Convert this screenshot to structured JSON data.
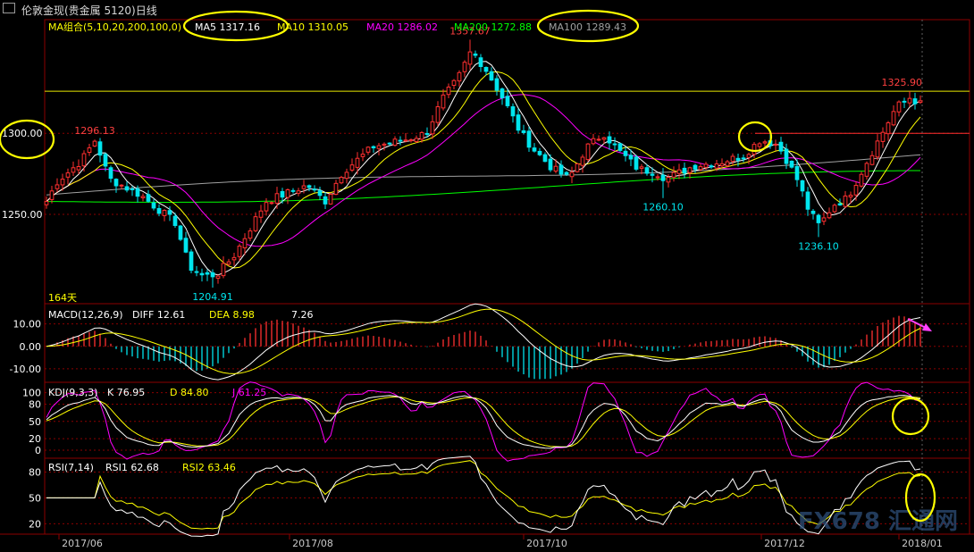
{
  "window": {
    "title": "伦敦金现(贵金属 5120)日线"
  },
  "main_panel": {
    "legend_prefix": "MA组合(5,10,20,200,100,0)",
    "ma_labels": [
      {
        "text": "MA5 1317.16",
        "color": "#ffffff"
      },
      {
        "text": "MA10 1310.05",
        "color": "#ffff00"
      },
      {
        "text": "MA20 1286.02",
        "color": "#ff00ff"
      },
      {
        "text": "MA200 1272.88",
        "color": "#00ff00"
      },
      {
        "text": "MA100 1289.43",
        "color": "#a0a0a0"
      }
    ],
    "bar_count_label": "164天",
    "price_ticks": [
      "1300.00",
      "1250.00"
    ],
    "annotations": [
      {
        "text": "1357.67",
        "color": "#ff4040"
      },
      {
        "text": "1325.90",
        "color": "#ff4040"
      },
      {
        "text": "1296.13",
        "color": "#ff4040"
      },
      {
        "text": "1260.10",
        "color": "#00e5ee"
      },
      {
        "text": "1236.10",
        "color": "#00e5ee"
      },
      {
        "text": "1204.91",
        "color": "#00e5ee"
      }
    ]
  },
  "macd_panel": {
    "prefix": "MACD(12,26,9)",
    "diff": "DIFF  12.61",
    "dea": "DEA  8.98",
    "macd": "7.26",
    "ticks": [
      "10.00",
      "0.00",
      "-10.00"
    ]
  },
  "kdj_panel": {
    "prefix": "KDJ(9,3,3)",
    "k": "K  76.95",
    "d": "D  84.80",
    "j": "J  61.25",
    "ticks": [
      "100",
      "80",
      "50",
      "20",
      "0"
    ]
  },
  "rsi_panel": {
    "prefix": "RSI(7,14)",
    "rsi1": "RSI1  62.68",
    "rsi2": "RSI2  63.46",
    "ticks": [
      "80",
      "50",
      "20"
    ]
  },
  "x_axis": {
    "labels": [
      "2017/06",
      "2017/08",
      "2017/10",
      "2017/12",
      "2018/01"
    ]
  },
  "watermark": {
    "text": "FX678 汇通网"
  },
  "colors": {
    "up": "#ff3030",
    "down": "#00e5ee",
    "grid": "#8b0000",
    "axis": "#8b0000",
    "highlight": "#ffff00"
  },
  "chart_data": [
    {
      "type": "candlestick",
      "title": "伦敦金现(贵金属 5120)日线",
      "x_ticks": [
        "2017/06",
        "2017/08",
        "2017/10",
        "2017/12",
        "2018/01"
      ],
      "y_ticks": [
        1300,
        1250
      ],
      "ylim": [
        1195,
        1370
      ],
      "key_points": [
        {
          "label": "1296.13",
          "value": 1296.13,
          "kind": "high"
        },
        {
          "label": "1204.91",
          "value": 1204.91,
          "kind": "low"
        },
        {
          "label": "1357.67",
          "value": 1357.67,
          "kind": "high"
        },
        {
          "label": "1260.10",
          "value": 1260.1,
          "kind": "low"
        },
        {
          "label": "1236.10",
          "value": 1236.1,
          "kind": "low"
        },
        {
          "label": "1325.90",
          "value": 1325.9,
          "kind": "high"
        }
      ],
      "reference_lines": [
        1325.9,
        1300
      ],
      "ma_latest": {
        "MA5": 1317.16,
        "MA10": 1310.05,
        "MA20": 1286.02,
        "MA200": 1272.88,
        "MA100": 1289.43
      }
    },
    {
      "type": "line",
      "title": "MACD(12,26,9)",
      "series": [
        {
          "name": "DIFF",
          "latest": 12.61
        },
        {
          "name": "DEA",
          "latest": 8.98
        },
        {
          "name": "MACD",
          "latest": 7.26
        }
      ],
      "y_ticks": [
        10,
        0,
        -10
      ]
    },
    {
      "type": "line",
      "title": "KDJ(9,3,3)",
      "series": [
        {
          "name": "K",
          "latest": 76.95
        },
        {
          "name": "D",
          "latest": 84.8
        },
        {
          "name": "J",
          "latest": 61.25
        }
      ],
      "y_ticks": [
        100,
        80,
        50,
        20,
        0
      ]
    },
    {
      "type": "line",
      "title": "RSI(7,14)",
      "series": [
        {
          "name": "RSI1",
          "latest": 62.68
        },
        {
          "name": "RSI2",
          "latest": 63.46
        }
      ],
      "y_ticks": [
        80,
        50,
        20
      ]
    }
  ]
}
